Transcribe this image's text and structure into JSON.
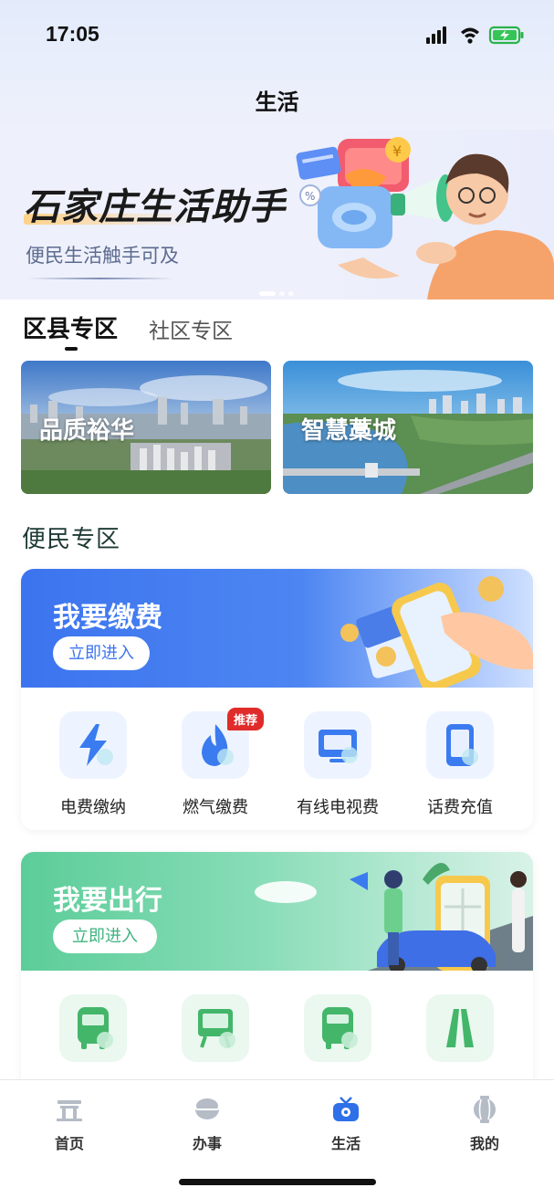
{
  "status_bar": {
    "time": "17:05"
  },
  "nav": {
    "title": "生活"
  },
  "banner": {
    "title": "石家庄生活助手",
    "subtitle": "便民生活触手可及"
  },
  "zone_tabs": {
    "active": "区县专区",
    "inactive": "社区专区"
  },
  "district_cards": [
    {
      "label": "品质裕华"
    },
    {
      "label": "智慧藁城"
    }
  ],
  "convenience_section": {
    "title": "便民专区"
  },
  "payment_card": {
    "title": "我要缴费",
    "button": "立即进入",
    "items": [
      {
        "label": "电费缴纳",
        "icon": "lightning-icon"
      },
      {
        "label": "燃气缴费",
        "icon": "flame-icon",
        "badge": "推荐"
      },
      {
        "label": "有线电视费",
        "icon": "tv-icon"
      },
      {
        "label": "话费充值",
        "icon": "phone-icon"
      }
    ]
  },
  "travel_card": {
    "title": "我要出行",
    "button": "立即进入",
    "items": [
      {
        "icon": "bus-icon"
      },
      {
        "icon": "bus-card-icon"
      },
      {
        "icon": "bus-pay-icon"
      },
      {
        "icon": "road-icon"
      }
    ]
  },
  "tabbar": {
    "items": [
      {
        "label": "首页",
        "icon": "gate-icon"
      },
      {
        "label": "办事",
        "icon": "bowl-icon"
      },
      {
        "label": "生活",
        "icon": "tv-antenna-icon",
        "active": true
      },
      {
        "label": "我的",
        "icon": "lantern-icon"
      }
    ]
  },
  "colors": {
    "payment_blue": "#3f78f0",
    "travel_green": "#5fcf9a",
    "tab_active": "#2f6fe8",
    "badge_red": "#e02b2b"
  }
}
